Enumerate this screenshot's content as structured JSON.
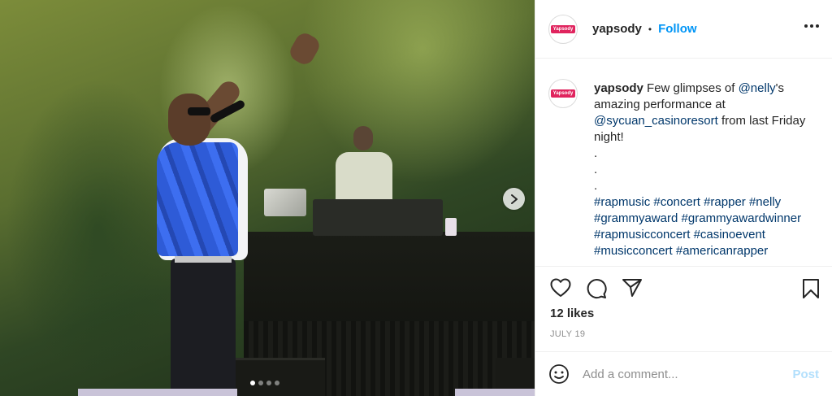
{
  "media": {
    "carousel_count": 4,
    "active_index": 0
  },
  "header": {
    "avatar_text": "Yapsody",
    "username": "yapsody",
    "separator": "•",
    "follow_label": "Follow"
  },
  "caption": {
    "username": "yapsody",
    "text_1": "Few glimpses of ",
    "mention_1": "@nelly",
    "text_2": "'s amazing performance at ",
    "mention_2": "@sycuan_casinoresort",
    "text_3": " from last Friday night!",
    "dots": [
      ".",
      ".",
      "."
    ],
    "hashtags": [
      "#rapmusic",
      "#concert",
      "#rapper",
      "#nelly",
      "#grammyaward",
      "#grammyawardwinner",
      "#rapmusicconcert",
      "#casinoevent",
      "#musicconcert",
      "#americanrapper"
    ]
  },
  "engagement": {
    "likes": "12 likes",
    "date": "JULY 19"
  },
  "comment": {
    "placeholder": "Add a comment...",
    "post_label": "Post"
  },
  "colors": {
    "accent": "#0095f6",
    "brand": "#e0245e",
    "post_disabled": "#b2dffc"
  }
}
